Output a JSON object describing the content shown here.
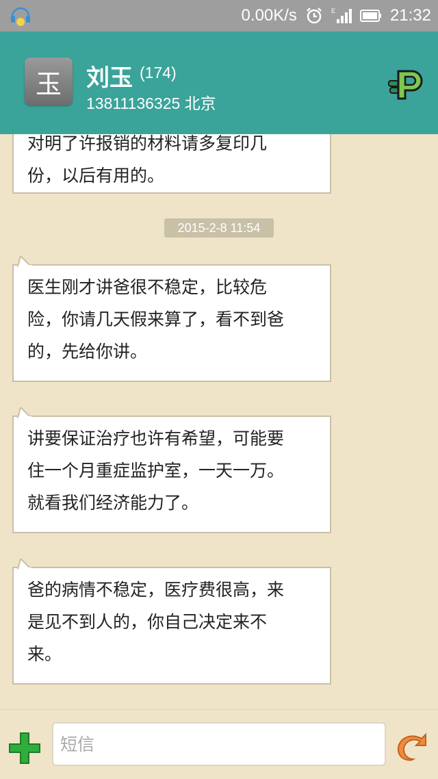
{
  "status_bar": {
    "speed": "0.00K/s",
    "time": "21:32"
  },
  "header": {
    "avatar_char": "玉",
    "name": "刘玉",
    "count": "(174)",
    "subtitle": "13811136325 北京"
  },
  "messages": {
    "timestamp": "2015-2-8 11:54",
    "partial": {
      "line1": "对明了许报销的材料请多复印几",
      "line2": "份，以后有用的。"
    },
    "items": [
      {
        "line1": "医生刚才讲爸很不稳定，比较危",
        "line2": "险，你请几天假来算了，看不到爸",
        "line3": "的，先给你讲。"
      },
      {
        "line1": "讲要保证治疗也许有希望，可能要",
        "line2": "住一个月重症监护室，一天一万。",
        "line3": "就看我们经济能力了。"
      },
      {
        "line1": "爸的病情不稳定，医疗费很高，来",
        "line2": "是见不到人的，你自己决定来不",
        "line3": "来。"
      }
    ]
  },
  "input": {
    "placeholder": "短信"
  },
  "colors": {
    "header": "#3aa39a",
    "background": "#efe4c8",
    "status_bar": "#9e9e9e"
  }
}
